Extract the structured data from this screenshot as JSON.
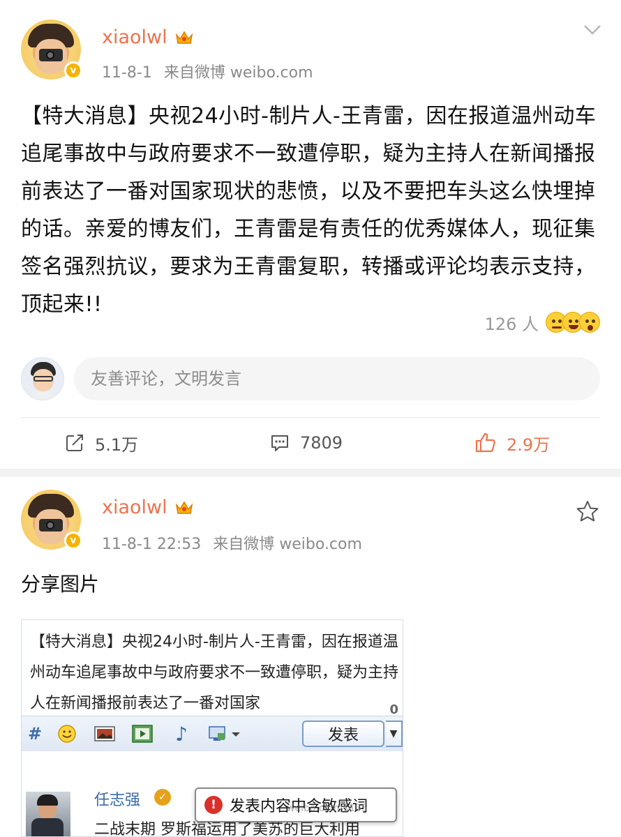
{
  "post1": {
    "username": "xiaolwl",
    "date": "11-8-1",
    "source": "来自微博 weibo.com",
    "text": "【特大消息】央视24小时-制片人-王青雷，因在报道温州动车追尾事故中与政府要求不一致遭停职，疑为主持人在新闻播报前表达了一番对国家现状的悲愤，以及不要把车头这么快埋掉的话。亲爱的博友们，王青雷是有责任的优秀媒体人，现征集签名强烈抗议，要求为王青雷复职，转播或评论均表示支持，顶起来!!",
    "reaction_count": "126 人",
    "comment_placeholder": "友善评论，文明发言",
    "reposts": "5.1万",
    "comments": "7809",
    "likes": "2.9万"
  },
  "post2": {
    "username": "xiaolwl",
    "datetime": "11-8-1 22:53",
    "source": "来自微博 weibo.com",
    "text": "分享图片",
    "image": {
      "text": "【特大消息】央视24小时-制片人-王青雷，因在报道温州动车追尾事故中与政府要求不一致遭停职，疑为主持人在新闻播报前表达了一番对国家",
      "counter": "0",
      "publish_label": "发表",
      "feed_name": "任志强",
      "feed_line": "二战末期 罗斯福运用了美苏的巨大利用",
      "warning": "发表内容中含敏感词",
      "watermark": "weibo.com/1135"
    }
  },
  "colors": {
    "accent": "#eb7350",
    "meta": "#8a8a8a",
    "separator": "#f2f2f2"
  },
  "icons": [
    "chevron-down-icon",
    "star-icon",
    "repost-icon",
    "comment-icon",
    "like-icon",
    "crown-icon",
    "verified-icon",
    "warning-icon"
  ]
}
